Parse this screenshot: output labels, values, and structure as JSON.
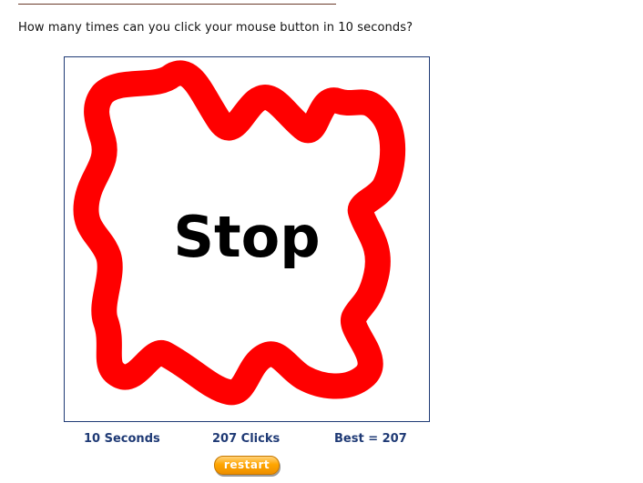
{
  "question": "How many times can you click your mouse button in 10 seconds?",
  "game": {
    "center_text": "Stop",
    "scribble_color": "#ff0000",
    "border_color": "#1f3a75"
  },
  "stats": {
    "seconds_label": "10 Seconds",
    "clicks_label": "207 Clicks",
    "best_label": "Best = 207"
  },
  "restart": {
    "label": "restart",
    "color": "#ffa600"
  }
}
